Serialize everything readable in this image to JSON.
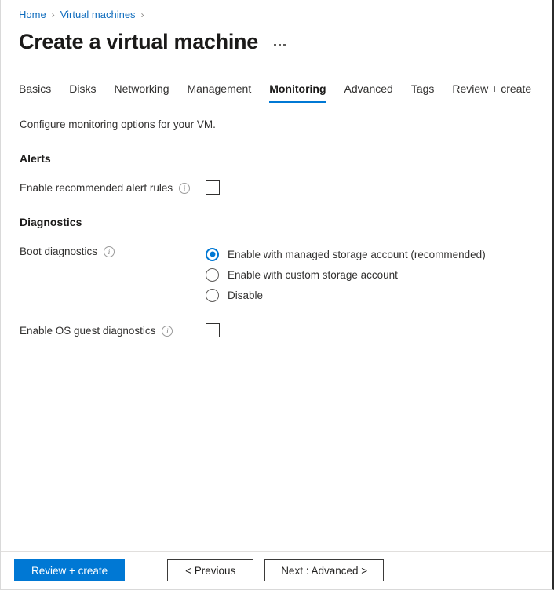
{
  "breadcrumb": {
    "items": [
      {
        "label": "Home"
      },
      {
        "label": "Virtual machines"
      }
    ],
    "separator": "›"
  },
  "header": {
    "title": "Create a virtual machine",
    "more_menu": "more-options"
  },
  "tabs": [
    {
      "label": "Basics",
      "active": false
    },
    {
      "label": "Disks",
      "active": false
    },
    {
      "label": "Networking",
      "active": false
    },
    {
      "label": "Management",
      "active": false
    },
    {
      "label": "Monitoring",
      "active": true
    },
    {
      "label": "Advanced",
      "active": false
    },
    {
      "label": "Tags",
      "active": false
    },
    {
      "label": "Review + create",
      "active": false
    }
  ],
  "main": {
    "intro": "Configure monitoring options for your VM.",
    "alerts": {
      "heading": "Alerts",
      "enable_recommended_alert_rules": {
        "label": "Enable recommended alert rules",
        "checked": false,
        "info": "i"
      }
    },
    "diagnostics": {
      "heading": "Diagnostics",
      "boot_diagnostics": {
        "label": "Boot diagnostics",
        "info": "i",
        "options": [
          {
            "label": "Enable with managed storage account (recommended)",
            "selected": true
          },
          {
            "label": "Enable with custom storage account",
            "selected": false
          },
          {
            "label": "Disable",
            "selected": false
          }
        ]
      },
      "os_guest_diagnostics": {
        "label": "Enable OS guest diagnostics",
        "checked": false,
        "info": "i"
      }
    }
  },
  "footer": {
    "review_create": "Review + create",
    "previous": "< Previous",
    "next": "Next : Advanced >"
  },
  "colors": {
    "accent": "#0078d4",
    "link": "#0f6cbd",
    "text": "#323130"
  }
}
